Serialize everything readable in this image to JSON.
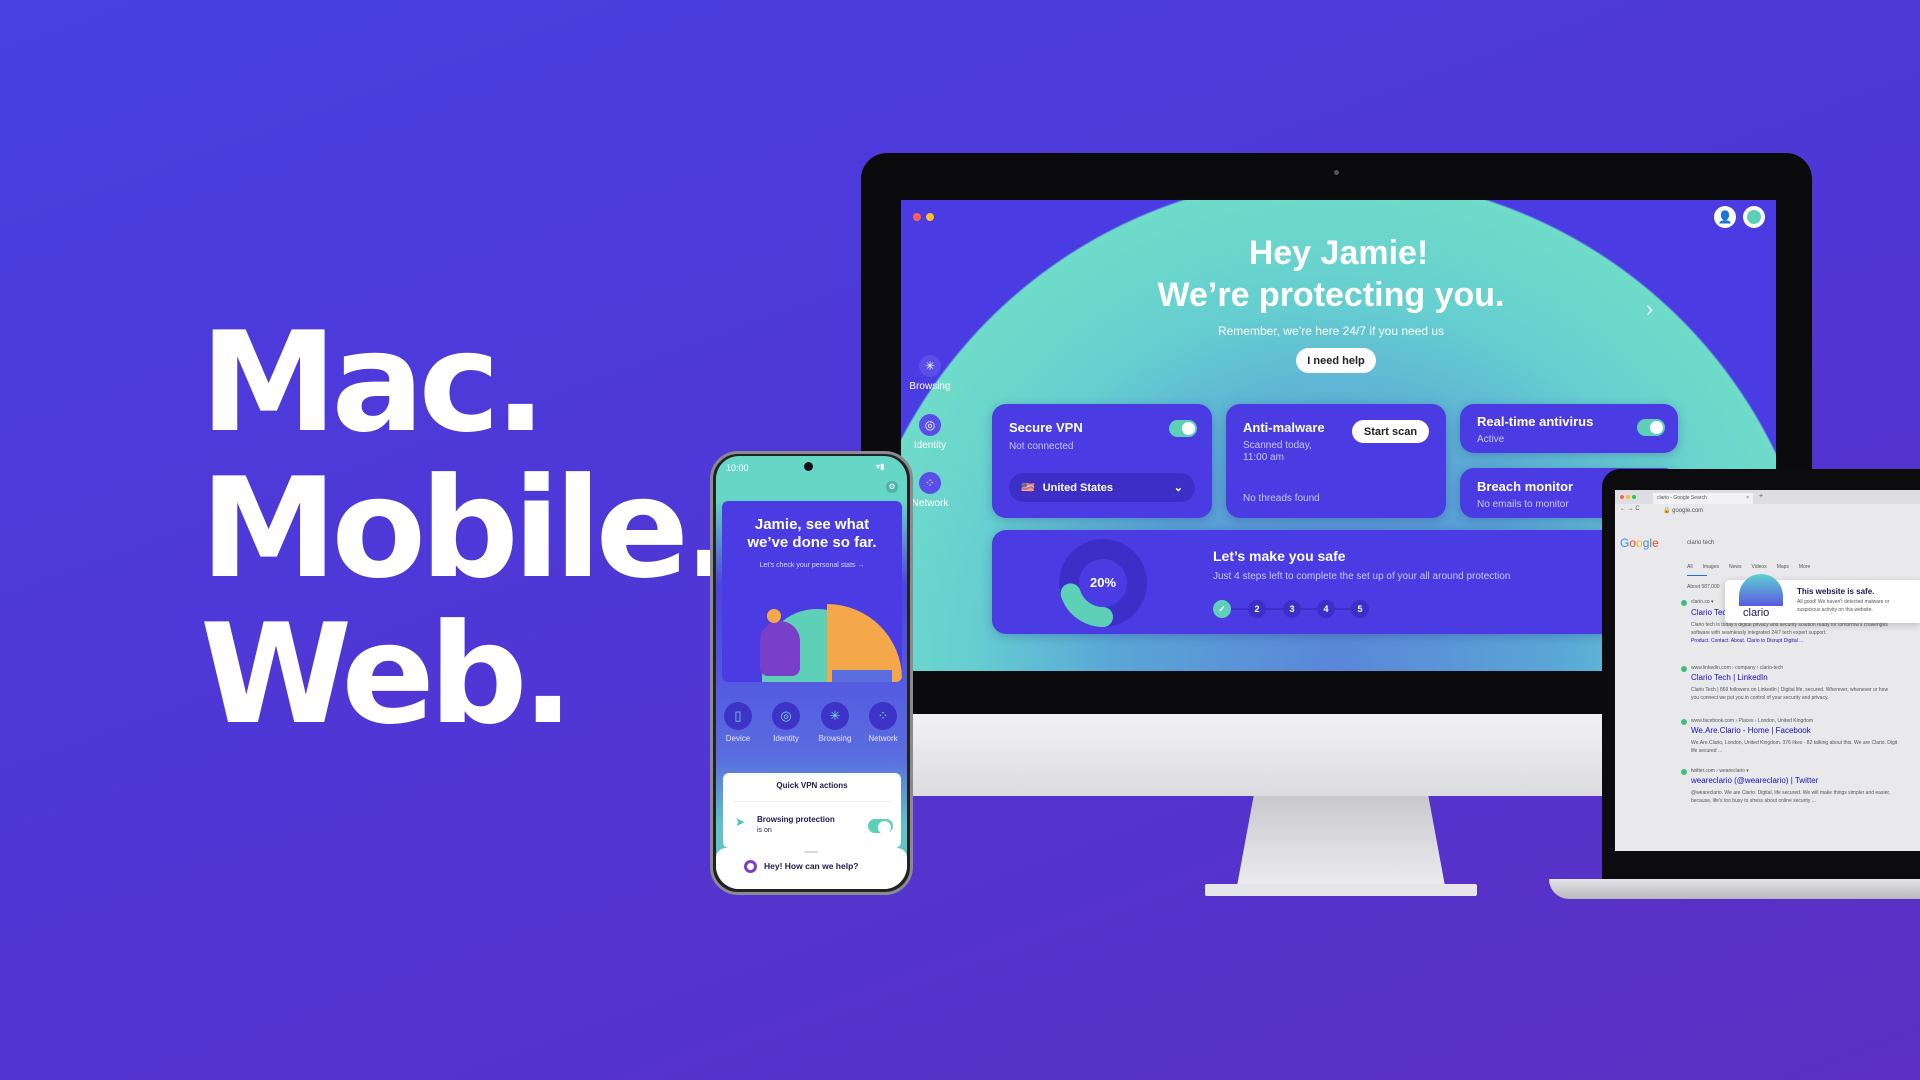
{
  "hero": {
    "lines": [
      "Mac.",
      "Mobile.",
      "Web."
    ]
  },
  "colors": {
    "background": "#4a3de0",
    "accent_teal": "#5ed0b8",
    "card": "#4a3ce2"
  },
  "desktop": {
    "greeting": "Hey Jamie!",
    "headline": "We’re protecting you.",
    "subtitle": "Remember, we’re here 24/7 if you need us",
    "help_button": "I need help",
    "sidebar": [
      {
        "label": "Browsing",
        "icon": "cursor-icon"
      },
      {
        "label": "Identity",
        "icon": "identity-icon"
      },
      {
        "label": "Network",
        "icon": "network-icon"
      }
    ],
    "vpn": {
      "title": "Secure VPN",
      "status": "Not connected",
      "enabled": true,
      "country": "United States"
    },
    "antimalware": {
      "title": "Anti-malware",
      "scanned": "Scanned today,",
      "time": "11:00 am",
      "result": "No threads found",
      "button": "Start scan"
    },
    "antivirus": {
      "title": "Real-time antivirus",
      "status": "Active",
      "enabled": true
    },
    "breach": {
      "title": "Breach monitor",
      "status": "No emails to monitor"
    },
    "setup": {
      "title": "Let’s make you safe",
      "subtitle": "Just 4 steps left to complete the set up of your all around protection",
      "progress_label": "20%",
      "progress": 0.2,
      "steps": [
        "1",
        "2",
        "3",
        "4",
        "5"
      ],
      "completed_steps": 1
    }
  },
  "mobile": {
    "time": "10:00",
    "title_line1": "Jamie, see what",
    "title_line2": "we’ve done so far.",
    "stats_link": "Let’s check your personal stats →",
    "nav": [
      {
        "label": "Device",
        "icon": "phone-icon"
      },
      {
        "label": "Identity",
        "icon": "identity-icon"
      },
      {
        "label": "Browsing",
        "icon": "cursor-icon"
      },
      {
        "label": "Network",
        "icon": "network-icon"
      }
    ],
    "quick_title": "Quick VPN actions",
    "browsing_protection": "Browsing protection",
    "browsing_status": "is on",
    "chat": "Hey! How can we help?"
  },
  "web": {
    "tab": "clario - Google Search",
    "url": "google.com",
    "query": "clario tech",
    "search_tabs": [
      "All",
      "Images",
      "News",
      "Videos",
      "Maps",
      "More"
    ],
    "about": "About 587,000",
    "popup": {
      "title": "This website is safe.",
      "body_line1": "All good! We haven't detected malware or",
      "body_line2": "suspicious activity on this website.",
      "logo": "clario"
    },
    "results": [
      {
        "cite": "clario.co ▾",
        "title": "Clario Tech",
        "desc1": "Clario tech is today's digital privacy and security solution ready for tomorrow's challenges",
        "desc2": "software with seamlessly integrated 24/7 tech expert support.",
        "links": "Product.  Contact.  About.  Clario to Disrupt Digital ..."
      },
      {
        "cite": "www.linkedin.com › company › clario-tech",
        "title": "Clario Tech | LinkedIn",
        "desc1": "Clario Tech | 869 followers on LinkedIn | Digital life, secured. Wherever, whenever or how",
        "desc2": "you connect we put you in control of your security and privacy."
      },
      {
        "cite": "www.facebook.com › Places › London, United Kingdom",
        "title": "We.Are.Clario - Home | Facebook",
        "desc1": "We.Are.Clario, London, United Kingdom. 376 likes · 82 talking about this. We are Clario. Digit",
        "desc2": "life secured ..."
      },
      {
        "cite": "twitter.com › weareclario ▾",
        "title": "weareclario (@weareclario) | Twitter",
        "desc1": "@weareclario. We are Clario. Digital, life secured. We will make things simpler and easier,",
        "desc2": "because, life's too busy to stress about online security ..."
      }
    ]
  }
}
